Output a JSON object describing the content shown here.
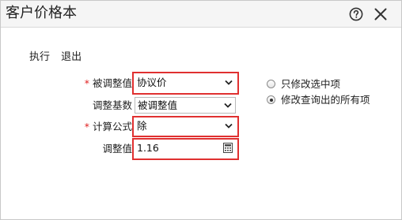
{
  "window": {
    "title": "客户价格本"
  },
  "toolbar": {
    "execute_label": "执行",
    "exit_label": "退出"
  },
  "form": {
    "adjusted_value": {
      "required_mark": "*",
      "label": "被调整值",
      "value": "协议价"
    },
    "adjust_base": {
      "label": "调整基数",
      "value": "被调整值"
    },
    "formula": {
      "required_mark": "*",
      "label": "计算公式",
      "value": "除"
    },
    "adjust_amount": {
      "label": "调整值",
      "value": "1.16"
    }
  },
  "scope_options": [
    {
      "label": "只修改选中项",
      "checked": false
    },
    {
      "label": "修改查询出的所有项",
      "checked": true
    }
  ],
  "colors": {
    "highlight": "#e03030",
    "required": "#e02020",
    "titlebar_bg": "#f5f5f5"
  },
  "icons": {
    "help": "help-circle-icon",
    "close": "close-icon",
    "dropdown": "chevron-down-icon",
    "calculator": "calculator-icon"
  }
}
